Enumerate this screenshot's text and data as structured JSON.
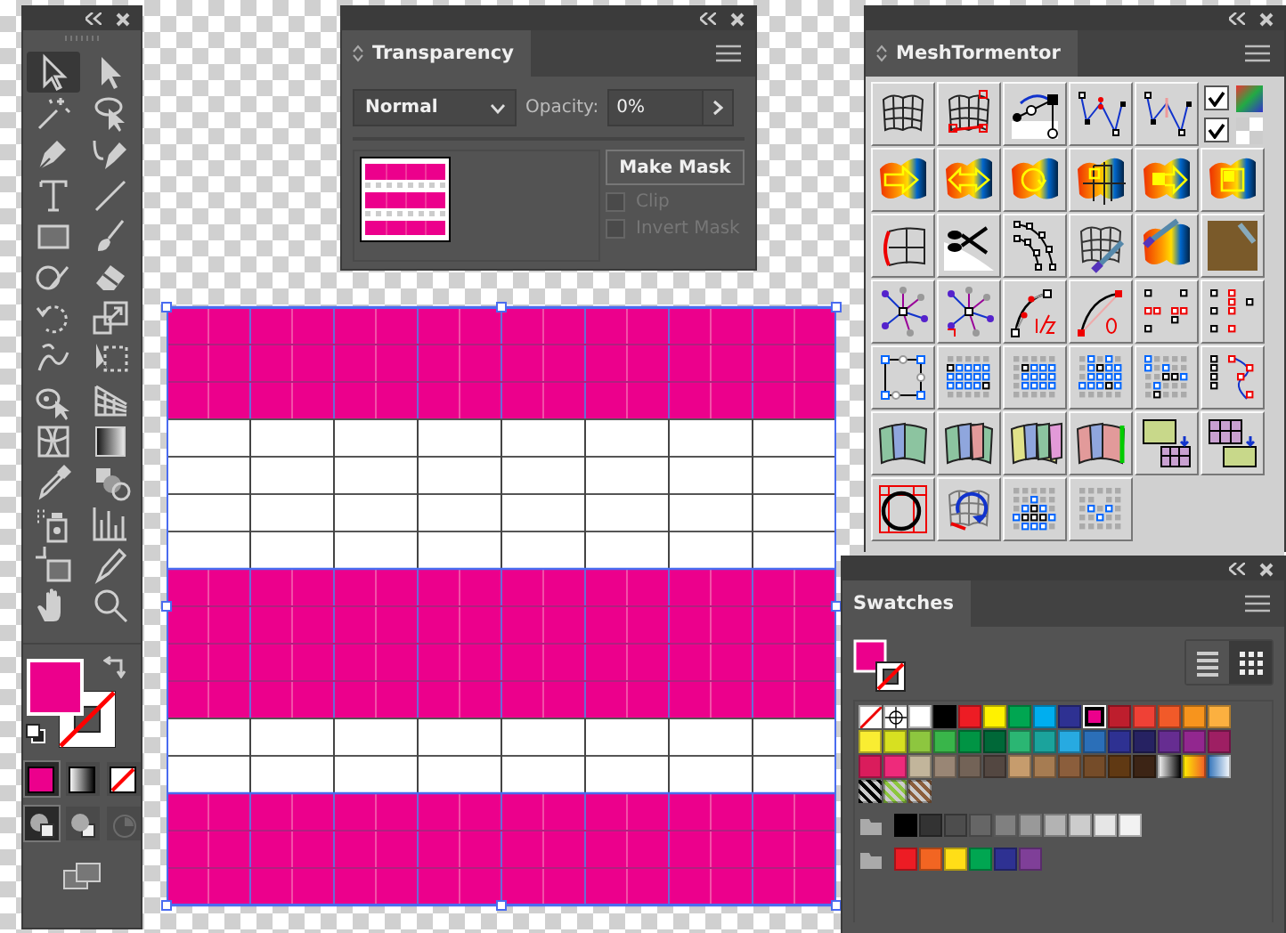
{
  "tools": {
    "items": [
      {
        "kind": "arrow-outline",
        "selected": true
      },
      {
        "kind": "arrow-solid",
        "selected": false
      },
      {
        "kind": "wand",
        "selected": false
      },
      {
        "kind": "lasso",
        "selected": false
      },
      {
        "kind": "pen",
        "selected": false
      },
      {
        "kind": "pen-curve",
        "selected": false
      },
      {
        "kind": "type",
        "selected": false
      },
      {
        "kind": "line",
        "selected": false
      },
      {
        "kind": "rectangle",
        "selected": false
      },
      {
        "kind": "brush",
        "selected": false
      },
      {
        "kind": "shaper",
        "selected": false
      },
      {
        "kind": "eraser",
        "selected": false
      },
      {
        "kind": "rotate",
        "selected": false
      },
      {
        "kind": "scale",
        "selected": false
      },
      {
        "kind": "warp",
        "selected": false
      },
      {
        "kind": "free-transform",
        "selected": false
      },
      {
        "kind": "shape-builder",
        "selected": false
      },
      {
        "kind": "perspective-grid",
        "selected": false
      },
      {
        "kind": "mesh",
        "selected": false
      },
      {
        "kind": "gradient",
        "selected": false
      },
      {
        "kind": "eyedropper",
        "selected": false
      },
      {
        "kind": "blend",
        "selected": false
      },
      {
        "kind": "sprayer",
        "selected": false
      },
      {
        "kind": "bar-chart",
        "selected": false
      },
      {
        "kind": "artboard",
        "selected": false
      },
      {
        "kind": "slice",
        "selected": false
      },
      {
        "kind": "hand",
        "selected": false
      },
      {
        "kind": "magnifier",
        "selected": false
      }
    ],
    "fill": {
      "color": "#ec008c"
    },
    "stroke": {
      "kind": "none"
    },
    "color_modes": [
      {
        "kind": "color",
        "selected": true
      },
      {
        "kind": "gradient",
        "selected": false
      },
      {
        "kind": "none",
        "selected": false
      }
    ],
    "draw_modes": [
      {
        "kind": "normal",
        "selected": true,
        "disabled": false
      },
      {
        "kind": "behind",
        "selected": false,
        "disabled": false
      },
      {
        "kind": "inside",
        "selected": false,
        "disabled": true
      }
    ]
  },
  "transparency": {
    "tab": "Transparency",
    "blend_mode": "Normal",
    "opacity_label": "Opacity:",
    "opacity": "0%",
    "mask_button": "Make Mask",
    "options": [
      {
        "label": "Clip",
        "checked": false,
        "disabled": true
      },
      {
        "label": "Invert Mask",
        "checked": false,
        "disabled": true
      }
    ]
  },
  "mesh_tormentor": {
    "tab": "MeshTormentor",
    "rows": [
      {
        "buttons": [
          {
            "kind": "mesh"
          },
          {
            "kind": "mesh-points"
          },
          {
            "kind": "curve-handles"
          },
          {
            "kind": "path-points"
          },
          {
            "kind": "path-points-faded"
          }
        ],
        "toggles": [
          {
            "checked": true
          },
          {
            "checked": true
          }
        ]
      },
      {
        "buttons": [
          {
            "kind": "gradient-arrow"
          },
          {
            "kind": "gradient-double-arrow"
          },
          {
            "kind": "gradient-rotate"
          },
          {
            "kind": "gradient-grid"
          },
          {
            "kind": "gradient-square-arrow"
          },
          {
            "kind": "gradient-square"
          }
        ]
      },
      {
        "buttons": [
          {
            "kind": "mesh-edge"
          },
          {
            "kind": "scissors"
          },
          {
            "kind": "arc-points"
          },
          {
            "kind": "mesh-brush"
          },
          {
            "kind": "gradient-brush"
          },
          {
            "kind": "picture"
          }
        ]
      },
      {
        "buttons": [
          {
            "kind": "star-points"
          },
          {
            "kind": "star-points-right-angle"
          },
          {
            "kind": "curve-third"
          },
          {
            "kind": "curve-zero"
          },
          {
            "kind": "dot-pattern"
          },
          {
            "kind": "dot-column"
          }
        ]
      },
      {
        "buttons": [
          {
            "kind": "quad-points"
          },
          {
            "kind": "dot-grid"
          },
          {
            "kind": "dot-grid-rows"
          },
          {
            "kind": "dot-grid-mixed"
          },
          {
            "kind": "dot-grid-corner"
          },
          {
            "kind": "dot-curve"
          }
        ]
      },
      {
        "buttons": [
          {
            "kind": "patch-two"
          },
          {
            "kind": "patch-three"
          },
          {
            "kind": "patch-many"
          },
          {
            "kind": "patch-edge"
          },
          {
            "kind": "grid-split"
          },
          {
            "kind": "grid-merge"
          }
        ]
      },
      {
        "buttons": [
          {
            "kind": "circle-frame"
          },
          {
            "kind": "mesh-rotate"
          },
          {
            "kind": "dot-diamond"
          },
          {
            "kind": "dot-sparse"
          }
        ]
      }
    ]
  },
  "swatches": {
    "tab": "Swatches",
    "fill": {
      "color": "#ec008c"
    },
    "stroke": {
      "kind": "none"
    },
    "views": [
      {
        "kind": "list",
        "selected": false
      },
      {
        "kind": "grid",
        "selected": true
      }
    ],
    "rows": [
      {
        "folder": false,
        "items": [
          {
            "kind": "none",
            "selected": false
          },
          {
            "kind": "registration",
            "selected": false
          },
          {
            "kind": "color",
            "color": "#ffffff",
            "selected": false
          },
          {
            "kind": "color",
            "color": "#000000",
            "selected": false
          },
          {
            "kind": "color",
            "color": "#ed1c24",
            "selected": false
          },
          {
            "kind": "color",
            "color": "#fff200",
            "selected": false
          },
          {
            "kind": "color",
            "color": "#00a651",
            "selected": false
          },
          {
            "kind": "color",
            "color": "#00aeef",
            "selected": false
          },
          {
            "kind": "color",
            "color": "#2e3192",
            "selected": false
          },
          {
            "kind": "color",
            "color": "#ec008c",
            "selected": true
          },
          {
            "kind": "color",
            "color": "#be1e2d",
            "selected": false
          },
          {
            "kind": "color",
            "color": "#ef4136",
            "selected": false
          },
          {
            "kind": "color",
            "color": "#f15a29",
            "selected": false
          },
          {
            "kind": "color",
            "color": "#f7941d",
            "selected": false
          },
          {
            "kind": "color",
            "color": "#fbb040",
            "selected": false
          }
        ]
      },
      {
        "folder": false,
        "items": [
          {
            "kind": "color",
            "color": "#f9ed32",
            "selected": false
          },
          {
            "kind": "color",
            "color": "#d7e021",
            "selected": false
          },
          {
            "kind": "color",
            "color": "#8dc63f",
            "selected": false
          },
          {
            "kind": "color",
            "color": "#39b54a",
            "selected": false
          },
          {
            "kind": "color",
            "color": "#009444",
            "selected": false
          },
          {
            "kind": "color",
            "color": "#006838",
            "selected": false
          },
          {
            "kind": "color",
            "color": "#2bb673",
            "selected": false
          },
          {
            "kind": "color",
            "color": "#1ba39c",
            "selected": false
          },
          {
            "kind": "color",
            "color": "#27aae1",
            "selected": false
          },
          {
            "kind": "color",
            "color": "#2b6fb8",
            "selected": false
          },
          {
            "kind": "color",
            "color": "#2e3192",
            "selected": false
          },
          {
            "kind": "color",
            "color": "#262262",
            "selected": false
          },
          {
            "kind": "color",
            "color": "#662d91",
            "selected": false
          },
          {
            "kind": "color",
            "color": "#92278f",
            "selected": false
          },
          {
            "kind": "color",
            "color": "#9e1f63",
            "selected": false
          }
        ]
      },
      {
        "folder": false,
        "items": [
          {
            "kind": "color",
            "color": "#da1c5c",
            "selected": false
          },
          {
            "kind": "color",
            "color": "#ee2a7b",
            "selected": false
          },
          {
            "kind": "color",
            "color": "#c2b59b",
            "selected": false
          },
          {
            "kind": "color",
            "color": "#998675",
            "selected": false
          },
          {
            "kind": "color",
            "color": "#736357",
            "selected": false
          },
          {
            "kind": "color",
            "color": "#534741",
            "selected": false
          },
          {
            "kind": "color",
            "color": "#c69c6d",
            "selected": false
          },
          {
            "kind": "color",
            "color": "#a67c52",
            "selected": false
          },
          {
            "kind": "color",
            "color": "#8b5e3c",
            "selected": false
          },
          {
            "kind": "color",
            "color": "#754c29",
            "selected": false
          },
          {
            "kind": "color",
            "color": "#603913",
            "selected": false
          },
          {
            "kind": "color",
            "color": "#3c2415",
            "selected": false
          },
          {
            "kind": "gradient-gray",
            "selected": false
          },
          {
            "kind": "gradient-warm",
            "selected": false
          },
          {
            "kind": "gradient-fade",
            "selected": false
          }
        ]
      },
      {
        "folder": false,
        "items": [
          {
            "kind": "pattern",
            "color": "#000000",
            "selected": false
          },
          {
            "kind": "pattern",
            "color": "#8dc63f",
            "selected": false
          },
          {
            "kind": "pattern",
            "color": "#8b5e3c",
            "selected": false
          }
        ]
      },
      {
        "folder": true,
        "items": [
          {
            "kind": "color",
            "color": "#000000",
            "selected": false
          },
          {
            "kind": "color",
            "color": "#333333",
            "selected": false
          },
          {
            "kind": "color",
            "color": "#4d4d4d",
            "selected": false
          },
          {
            "kind": "color",
            "color": "#666666",
            "selected": false
          },
          {
            "kind": "color",
            "color": "#808080",
            "selected": false
          },
          {
            "kind": "color",
            "color": "#999999",
            "selected": false
          },
          {
            "kind": "color",
            "color": "#b3b3b3",
            "selected": false
          },
          {
            "kind": "color",
            "color": "#cccccc",
            "selected": false
          },
          {
            "kind": "color",
            "color": "#e6e6e6",
            "selected": false
          },
          {
            "kind": "color",
            "color": "#f2f2f2",
            "selected": false
          }
        ]
      },
      {
        "folder": true,
        "items": [
          {
            "kind": "color",
            "color": "#ed1c24",
            "selected": false
          },
          {
            "kind": "color",
            "color": "#f26522",
            "selected": false
          },
          {
            "kind": "color",
            "color": "#ffde17",
            "selected": false
          },
          {
            "kind": "color",
            "color": "#00a651",
            "selected": false
          },
          {
            "kind": "color",
            "color": "#2e3192",
            "selected": false
          },
          {
            "kind": "color",
            "color": "#7f3f98",
            "selected": false
          }
        ]
      }
    ]
  }
}
